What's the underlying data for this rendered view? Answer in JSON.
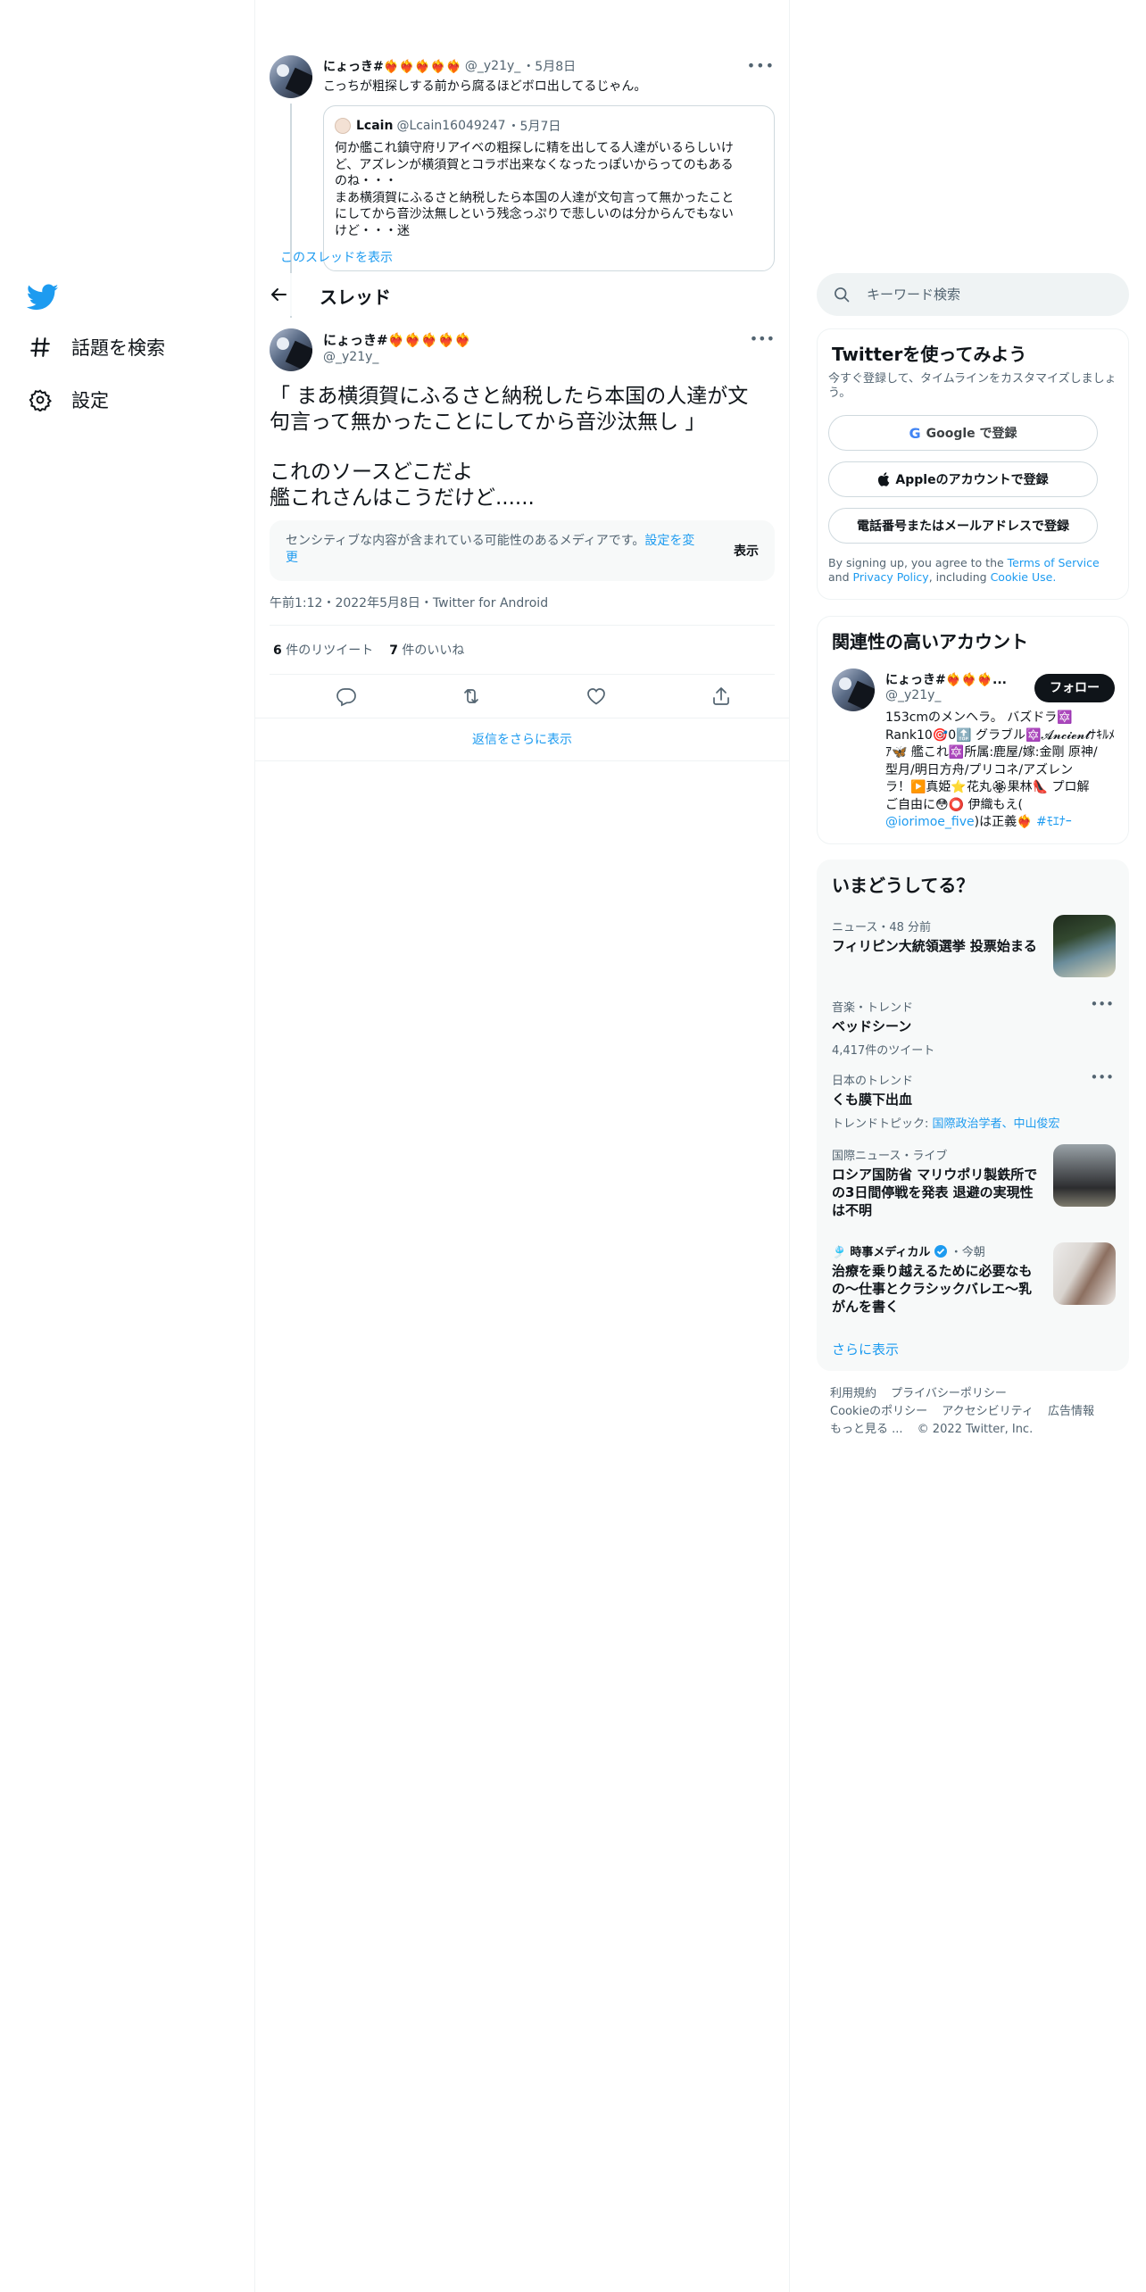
{
  "nav": {
    "explore_label": "話題を検索",
    "settings_label": "設定"
  },
  "parent_tweet": {
    "name": "にょっき#❤️‍🔥❤️‍🔥❤️‍🔥❤️‍🔥❤️‍🔥",
    "handle": "@_y21y_",
    "date": "・5月8日",
    "text": "こっちが粗探しする前から腐るほどボロ出してるじゃん。",
    "quote": {
      "name": "Lcain",
      "handle": "@Lcain16049247",
      "date": "・5月7日",
      "lines": [
        "何か艦これ鎮守府リアイベの粗探しに精を出してる人達がいるらしいけ",
        "ど、アズレンが横須賀とコラボ出来なくなったっぽいからってのもある",
        "のね・・・",
        "まあ横須賀にふるさと納税したら本国の人達が文句言って無かったこと",
        "にしてから音沙汰無しという残念っぷりで悲しいのは分からんでもない",
        "けど・・・迷"
      ],
      "show_thread": "このスレッドを表示"
    }
  },
  "header": {
    "title": "スレッド"
  },
  "tweet": {
    "name": "にょっき#❤️‍🔥❤️‍🔥❤️‍🔥❤️‍🔥❤️‍🔥",
    "handle": "@_y21y_",
    "text_lines": [
      "「 まあ横須賀にふるさと納税したら本国の人達が文",
      "句言って無かったことにしてから音沙汰無し 」",
      "",
      "これのソースどこだよ",
      "艦これさんはこうだけど......"
    ],
    "sensitive_text": "センシティブな内容が含まれている可能性のあるメディアです。",
    "sensitive_link": "設定を変更",
    "sensitive_button": "表示",
    "meta": "午前1:12・2022年5月8日・Twitter for Android",
    "retweets_count": "6",
    "retweets_label": "件のリツイート",
    "likes_count": "7",
    "likes_label": "件のいいね",
    "show_more_replies": "返信をさらに表示"
  },
  "search": {
    "placeholder": "キーワード検索"
  },
  "signup": {
    "title": "Twitterを使ってみよう",
    "subtitle": "今すぐ登録して、タイムラインをカスタマイズしましょう。",
    "google_button": "Google で登録",
    "apple_button": "Appleのアカウントで登録",
    "phone_button": "電話番号またはメールアドレスで登録",
    "terms_prefix": "By signing up, you agree to the",
    "terms_link": "Terms of Service",
    "terms_and": "and",
    "privacy_link": "Privacy Policy",
    "terms_including": ", including",
    "cookie_link": "Cookie Use."
  },
  "related": {
    "title": "関連性の高いアカウント",
    "name": "にょっき#❤️‍🔥❤️‍🔥❤️‍🔥...",
    "handle": "@_y21y_",
    "follow": "フォロー",
    "bio_lines": [
      "153cmのメンヘラ。 バズドラ🔯",
      "Rank10🎯0🔝 グラブル🔯𝓐𝓷𝓬𝓲𝓮𝓷𝓽ﾅｷﾙﾒ",
      "ｱ🦋 艦これ🔯所属:鹿屋/嫁:金剛 原神/",
      "型月/明日方舟/プリコネ/アズレン",
      "ラ！▶️真姫⭐️花丸🏵果林👠 プロ解",
      "ご自由に😳⭕️ 伊織もえ("
    ],
    "bio_link": "@iorimoe_five",
    "bio_after": ")は正義❤️‍🔥",
    "bio_hashtag": "#ﾓｴﾅｰ"
  },
  "trends": {
    "title": "いまどうしてる？",
    "items": [
      {
        "category": "ニュース・48 分前",
        "title": "フィリピン大統領選挙 投票始まる"
      },
      {
        "category": "音楽・トレンド",
        "title": "ベッドシーン",
        "sub": "4,417件のツイート"
      },
      {
        "category": "日本のトレンド",
        "title": "くも膜下出血",
        "sub_prefix": "トレンドトピック: ",
        "sub_link": "国際政治学者、中山俊宏"
      },
      {
        "category": "国際ニュース・ライブ",
        "title_lines": [
          "ロシア国防省 マリウポリ製鉄所で",
          "の3日間停戦を発表 退避の実現性",
          "は不明"
        ]
      },
      {
        "category_icon": "🎐",
        "category_name": "時事メディカル",
        "category_time": "・今朝",
        "title_lines": [
          "治療を乗り越えるために必要なも",
          "の～仕事とクラシックバレエ～乳",
          "がんを書く"
        ]
      }
    ],
    "show_more": "さらに表示"
  },
  "footer": {
    "links": [
      "利用規約",
      "プライバシーポリシー",
      "Cookieのポリシー",
      "アクセシビリティ",
      "広告情報",
      "もっと見る ..."
    ],
    "copyright": "© 2022 Twitter, Inc."
  },
  "colors": {
    "accent": "#1d9bf0",
    "text": "#0f1419",
    "muted": "#536471",
    "border": "#eff3f4"
  }
}
